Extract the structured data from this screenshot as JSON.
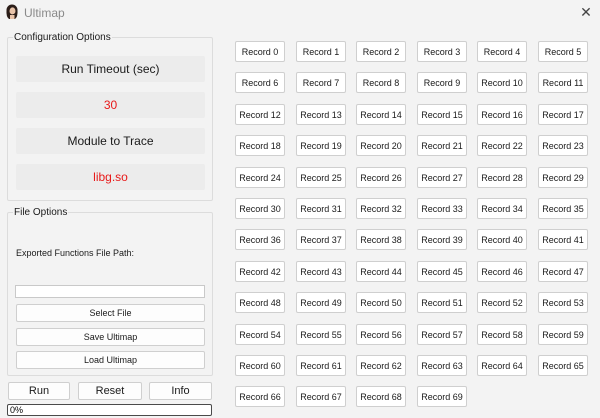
{
  "window": {
    "title": "Ultimap",
    "app_icon": "app-logo-icon",
    "close_glyph": "✕"
  },
  "config": {
    "group_title": "Configuration Options",
    "timeout_label": "Run Timeout (sec)",
    "timeout_value": "30",
    "module_label": "Module to Trace",
    "module_value": "libg.so",
    "value_color": "#e81a1a"
  },
  "file_options": {
    "group_title": "File Options",
    "path_label": "Exported Functions File Path:",
    "path_value": "",
    "select_label": "Select File",
    "save_label": "Save Ultimap",
    "load_label": "Load Ultimap"
  },
  "actions": {
    "run_label": "Run",
    "reset_label": "Reset",
    "info_label": "Info"
  },
  "progress": {
    "value": 0,
    "text": "0%",
    "fill_color": "#06b025"
  },
  "records": [
    "Record 0",
    "Record 1",
    "Record 2",
    "Record 3",
    "Record 4",
    "Record 5",
    "Record 6",
    "Record 7",
    "Record 8",
    "Record 9",
    "Record 10",
    "Record 11",
    "Record 12",
    "Record 13",
    "Record 14",
    "Record 15",
    "Record 16",
    "Record 17",
    "Record 18",
    "Record 19",
    "Record 20",
    "Record 21",
    "Record 22",
    "Record 23",
    "Record 24",
    "Record 25",
    "Record 26",
    "Record 27",
    "Record 28",
    "Record 29",
    "Record 30",
    "Record 31",
    "Record 32",
    "Record 33",
    "Record 34",
    "Record 35",
    "Record 36",
    "Record 37",
    "Record 38",
    "Record 39",
    "Record 40",
    "Record 41",
    "Record 42",
    "Record 43",
    "Record 44",
    "Record 45",
    "Record 46",
    "Record 47",
    "Record 48",
    "Record 49",
    "Record 50",
    "Record 51",
    "Record 52",
    "Record 53",
    "Record 54",
    "Record 55",
    "Record 56",
    "Record 57",
    "Record 58",
    "Record 59",
    "Record 60",
    "Record 61",
    "Record 62",
    "Record 63",
    "Record 64",
    "Record 65",
    "Record 66",
    "Record 67",
    "Record 68",
    "Record 69"
  ]
}
